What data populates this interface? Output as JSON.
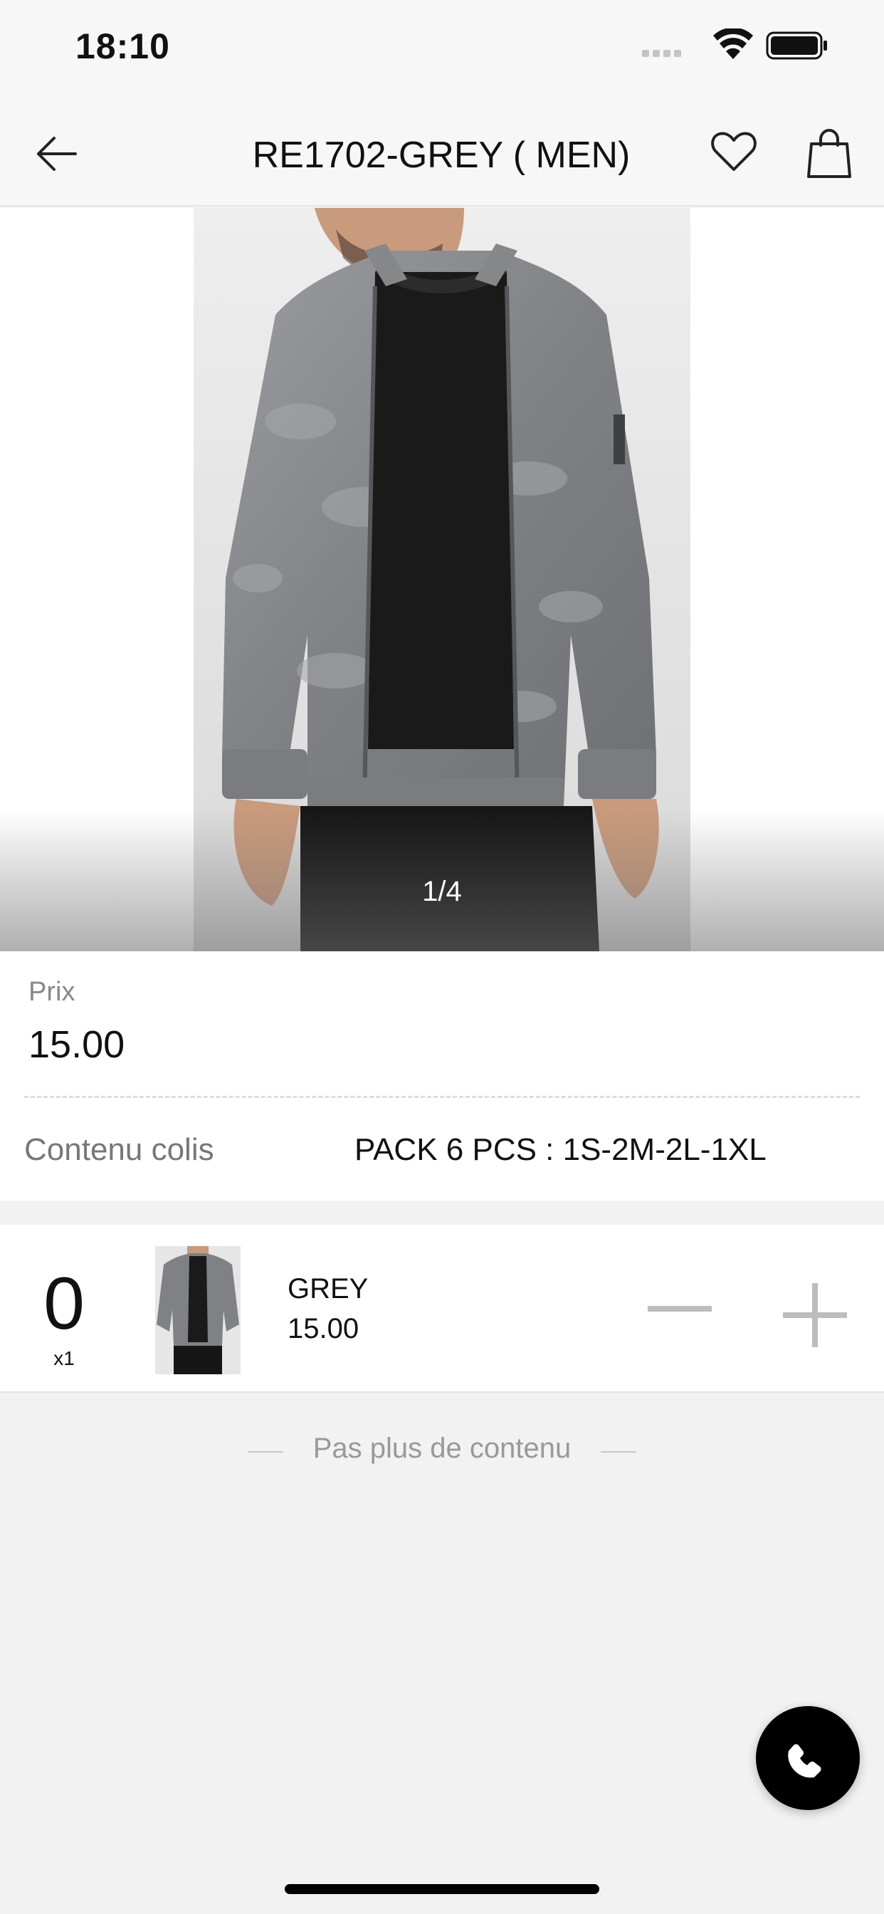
{
  "status_bar": {
    "time": "18:10"
  },
  "header": {
    "title": "RE1702-GREY ( MEN)"
  },
  "gallery": {
    "counter": "1/4"
  },
  "price_section": {
    "price_label": "Prix",
    "price_value": "15.00",
    "pack_label": "Contenu colis",
    "pack_value": "PACK 6 PCS : 1S-2M-2L-1XL"
  },
  "variant": {
    "quantity": "0",
    "unit": "x1",
    "color_name": "GREY",
    "price": "15.00"
  },
  "list_end_text": "Pas plus de contenu",
  "icons": {
    "back": "arrow-left-icon",
    "favorite": "heart-outline-icon",
    "cart": "shopping-bag-icon",
    "minus": "minus-icon",
    "plus": "plus-icon",
    "call": "phone-icon"
  },
  "colors": {
    "background": "#f2f2f2",
    "header": "#f7f7f7",
    "fab": "#000000",
    "muted_text": "#888888",
    "stepper": "#bdbdbd"
  }
}
